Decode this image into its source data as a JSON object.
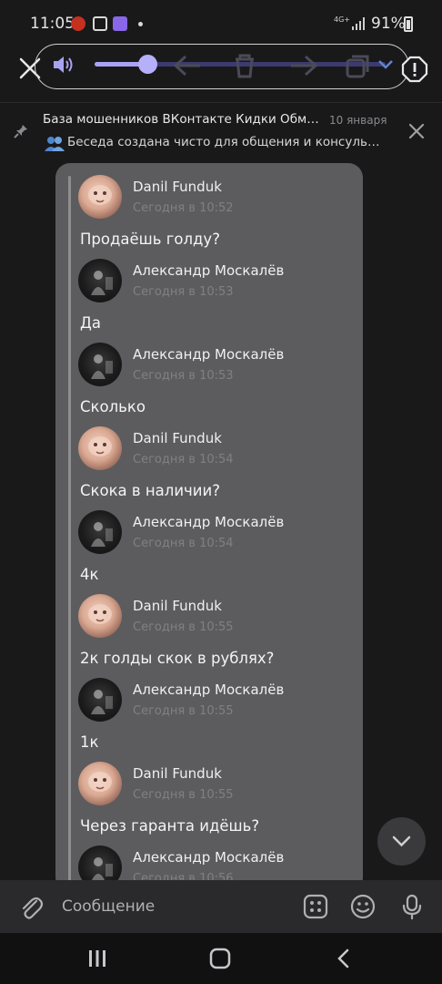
{
  "status_bar": {
    "time": "11:05",
    "network": "4G+",
    "battery": "91%"
  },
  "toolbar": {
    "volume_level": 0.18,
    "icons": [
      "close-icon",
      "volume-icon",
      "reply-icon",
      "delete-icon",
      "forward-icon",
      "copy-icon",
      "chevron-down-icon",
      "report-icon"
    ]
  },
  "pinned": {
    "title": "База мошенников ВКонтакте  Кидки Обман...",
    "date": "10 января",
    "text": "Беседа создана чисто для общения и консультац..."
  },
  "messages": [
    {
      "author": "Danil Funduk",
      "time": "Сегодня в 10:52",
      "text": "Продаёшь голду?",
      "avatar": "danil"
    },
    {
      "author": "Александр Москалёв",
      "time": "Сегодня в 10:53",
      "text": "Да",
      "avatar": "alex"
    },
    {
      "author": "Александр Москалёв",
      "time": "Сегодня в 10:53",
      "text": "Сколько",
      "avatar": "alex"
    },
    {
      "author": "Danil Funduk",
      "time": "Сегодня в 10:54",
      "text": "Скока в наличии?",
      "avatar": "danil"
    },
    {
      "author": "Александр Москалёв",
      "time": "Сегодня в 10:54",
      "text": "4к",
      "avatar": "alex"
    },
    {
      "author": "Danil Funduk",
      "time": "Сегодня в 10:55",
      "text": "2к голды скок в рублях?",
      "avatar": "danil"
    },
    {
      "author": "Александр Москалёв",
      "time": "Сегодня в 10:55",
      "text": "1к",
      "avatar": "alex"
    },
    {
      "author": "Danil Funduk",
      "time": "Сегодня в 10:55",
      "text": "Через гаранта идёшь?",
      "avatar": "danil"
    },
    {
      "author": "Александр Москалёв",
      "time": "Сегодня в 10:56",
      "text": "",
      "avatar": "alex"
    }
  ],
  "input": {
    "placeholder": "Сообщение"
  },
  "colors": {
    "accent": "#a9a3f2",
    "card": "#5c5c5e",
    "background": "#19191a"
  }
}
